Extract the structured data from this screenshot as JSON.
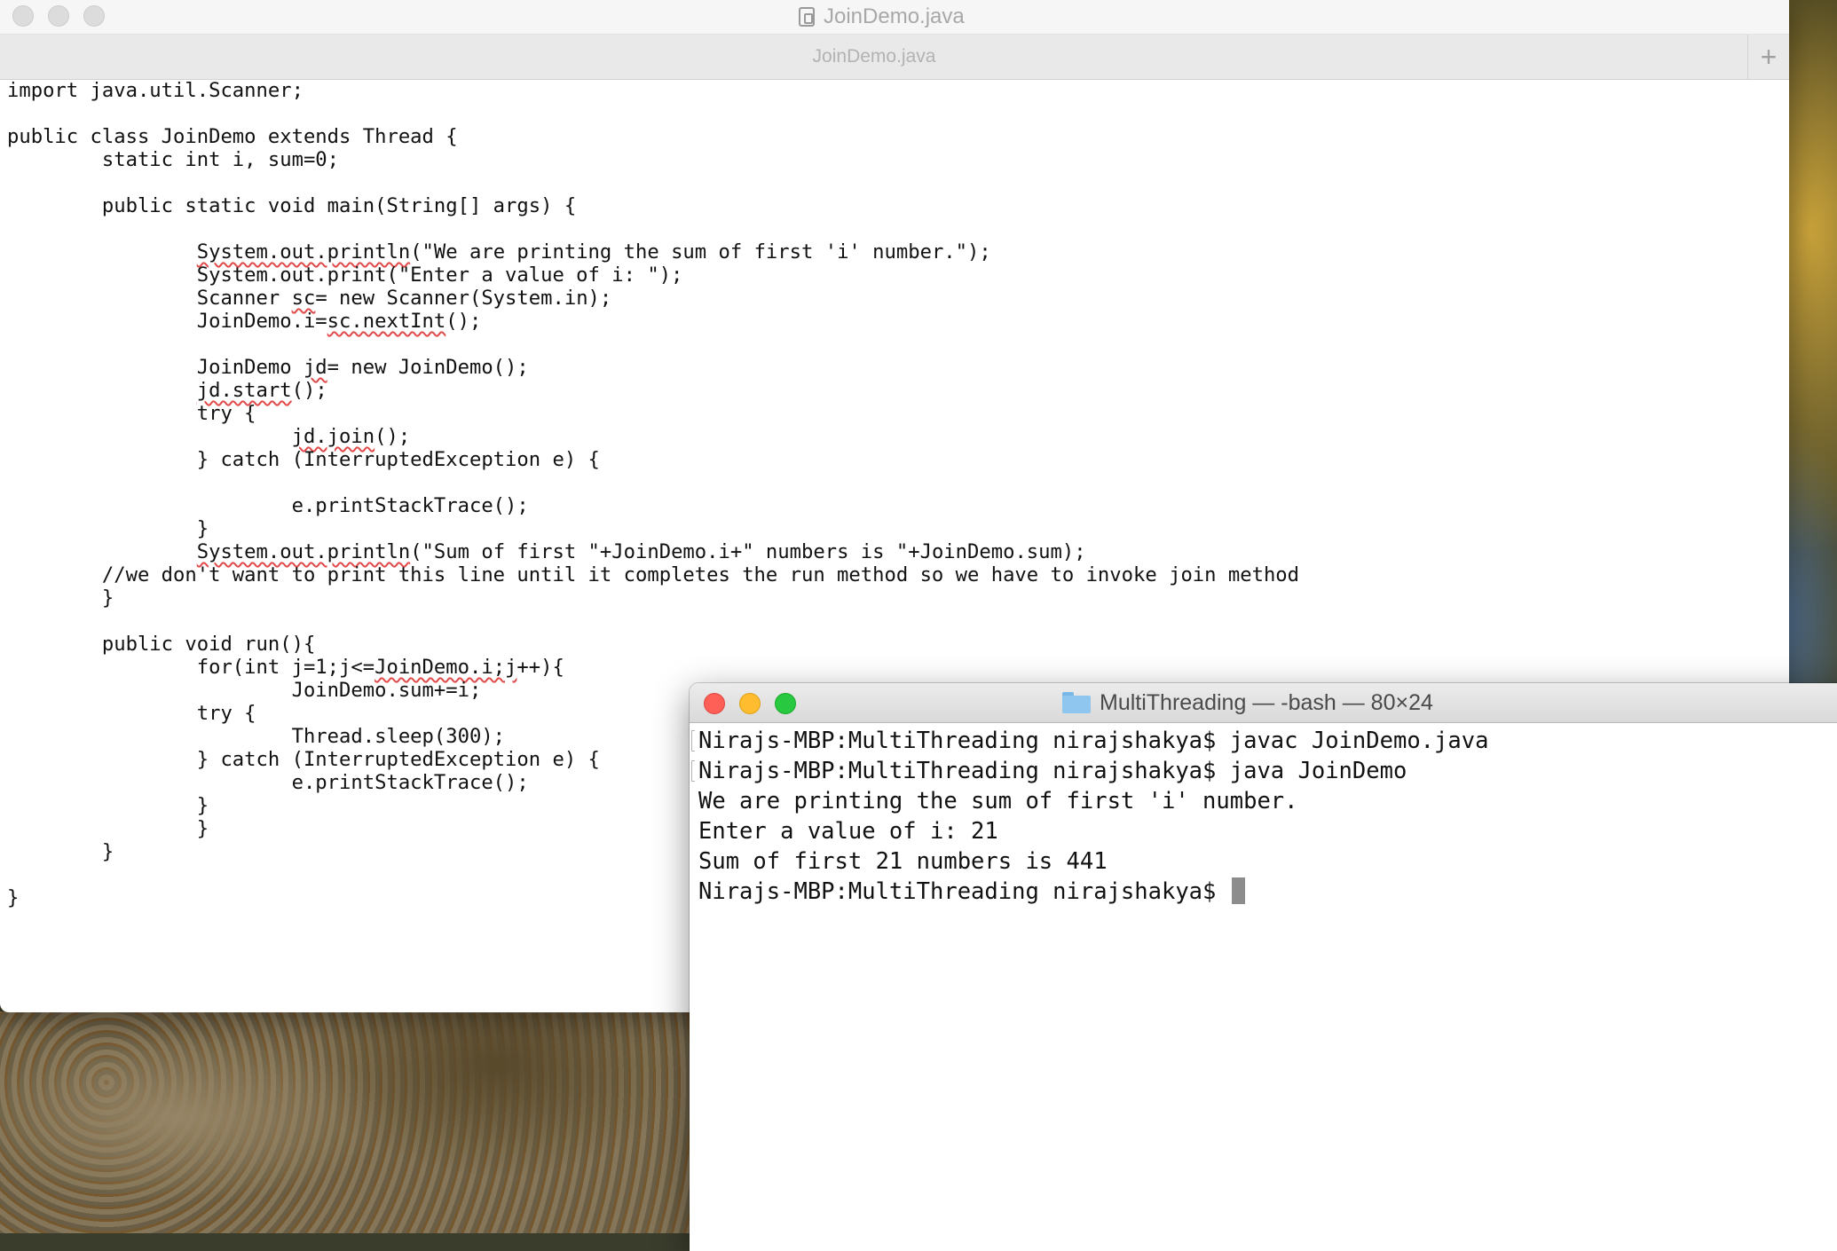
{
  "editor": {
    "window_title": "JoinDemo.java",
    "tab_label": "JoinDemo.java",
    "new_tab": "+",
    "lines": [
      [
        "import java.util.Scanner;"
      ],
      [
        ""
      ],
      [
        "public class JoinDemo extends Thread {"
      ],
      [
        "\tstatic int i, sum=0;"
      ],
      [
        ""
      ],
      [
        "\tpublic static void main(String[] args) {"
      ],
      [
        ""
      ],
      [
        "\t\t",
        {
          "t": "System.out.println",
          "sq": true
        },
        "(\"We are printing the sum of first 'i' number.\");"
      ],
      [
        "\t\tSystem.out.print(\"Enter a value of i: \");"
      ],
      [
        "\t\tScanner ",
        {
          "t": "sc",
          "sq": true
        },
        "= new Scanner(System.in);"
      ],
      [
        "\t\tJoinDemo.i=",
        {
          "t": "sc.nextInt",
          "sq": true
        },
        "();"
      ],
      [
        ""
      ],
      [
        "\t\tJoinDemo ",
        {
          "t": "jd",
          "sq": true
        },
        "= new JoinDemo();"
      ],
      [
        "\t\t",
        {
          "t": "jd.start",
          "sq": true
        },
        "();"
      ],
      [
        "\t\ttry {"
      ],
      [
        "\t\t\t",
        {
          "t": "jd.join",
          "sq": true
        },
        "();"
      ],
      [
        "\t\t} catch (InterruptedException e) {"
      ],
      [
        ""
      ],
      [
        "\t\t\te.printStackTrace();"
      ],
      [
        "\t\t}"
      ],
      [
        "\t\t",
        {
          "t": "System.out.println",
          "sq": true
        },
        "(\"Sum of first \"+JoinDemo.i+\" numbers is \"+JoinDemo.sum);"
      ],
      [
        "\t//we don't want to print this line until it completes the run method so we have to invoke join method"
      ],
      [
        "\t}"
      ],
      [
        ""
      ],
      [
        "\tpublic void run(){"
      ],
      [
        "\t\tfor(int j=1;j<=",
        {
          "t": "JoinDemo.i;j",
          "sq": true
        },
        "++){"
      ],
      [
        "\t\t\tJoinDemo.sum+=i;"
      ],
      [
        "\t\ttry {"
      ],
      [
        "\t\t\tThread.sleep(300);"
      ],
      [
        "\t\t} catch (InterruptedException e) {"
      ],
      [
        "\t\t\te.printStackTrace();"
      ],
      [
        "\t\t}"
      ],
      [
        "\t\t}"
      ],
      [
        "\t}"
      ],
      [
        ""
      ],
      [
        "}"
      ]
    ]
  },
  "terminal": {
    "title": "MultiThreading — -bash — 80×24",
    "lines": [
      {
        "text": "Nirajs-MBP:MultiThreading nirajshakya$ javac JoinDemo.java",
        "mark": true
      },
      {
        "text": "Nirajs-MBP:MultiThreading nirajshakya$ java JoinDemo",
        "mark": true
      },
      {
        "text": "We are printing the sum of first 'i' number.",
        "mark": false
      },
      {
        "text": "Enter a value of i: 21",
        "mark": false
      },
      {
        "text": "Sum of first 21 numbers is 441",
        "mark": false
      },
      {
        "text": "Nirajs-MBP:MultiThreading nirajshakya$ ",
        "mark": false,
        "cursor": true
      }
    ]
  },
  "colors": {
    "squiggle": "#e14a4a",
    "close": "#fe5f57",
    "minimize": "#febc2e",
    "maximize": "#28c840"
  }
}
